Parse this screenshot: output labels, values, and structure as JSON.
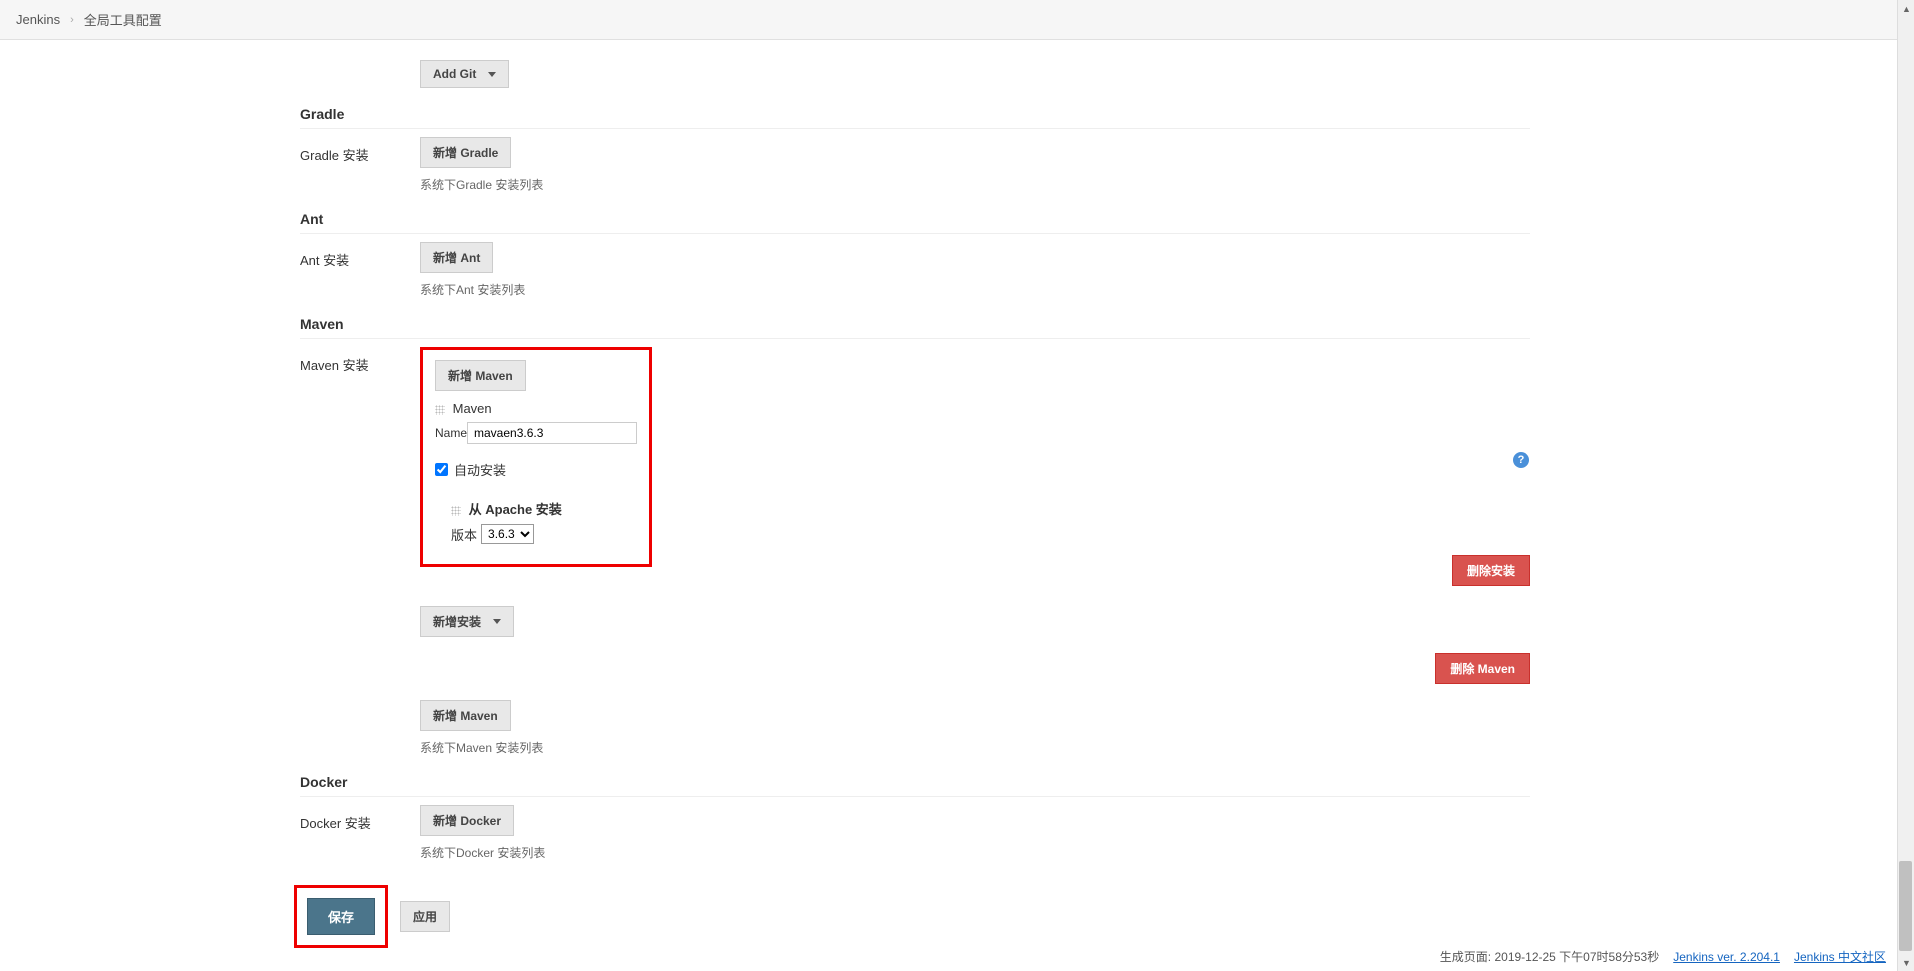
{
  "breadcrumb": {
    "home": "Jenkins",
    "page": "全局工具配置"
  },
  "git": {
    "add_button": "Add Git"
  },
  "gradle": {
    "header": "Gradle",
    "install_label": "Gradle 安装",
    "add_button": "新增 Gradle",
    "hint": "系统下Gradle 安装列表"
  },
  "ant": {
    "header": "Ant",
    "install_label": "Ant 安装",
    "add_button": "新增 Ant",
    "hint": "系统下Ant 安装列表"
  },
  "maven": {
    "header": "Maven",
    "install_label": "Maven 安装",
    "add_button_top": "新增 Maven",
    "item_title": "Maven",
    "name_label": "Name",
    "name_value": "mavaen3.6.3",
    "auto_install": "自动安装",
    "from_apache": "从 Apache 安装",
    "version_label": "版本",
    "version_value": "3.6.3",
    "delete_install": "删除安装",
    "add_install": "新增安装",
    "delete_maven": "删除 Maven",
    "add_button_bottom": "新增 Maven",
    "hint": "系统下Maven 安装列表"
  },
  "docker": {
    "header": "Docker",
    "install_label": "Docker 安装",
    "add_button": "新增 Docker",
    "hint": "系统下Docker 安装列表"
  },
  "actions": {
    "save": "保存",
    "apply": "应用"
  },
  "footer": {
    "generated": "生成页面: 2019-12-25 下午07时58分53秒",
    "version": "Jenkins ver. 2.204.1",
    "community": "Jenkins 中文社区"
  }
}
